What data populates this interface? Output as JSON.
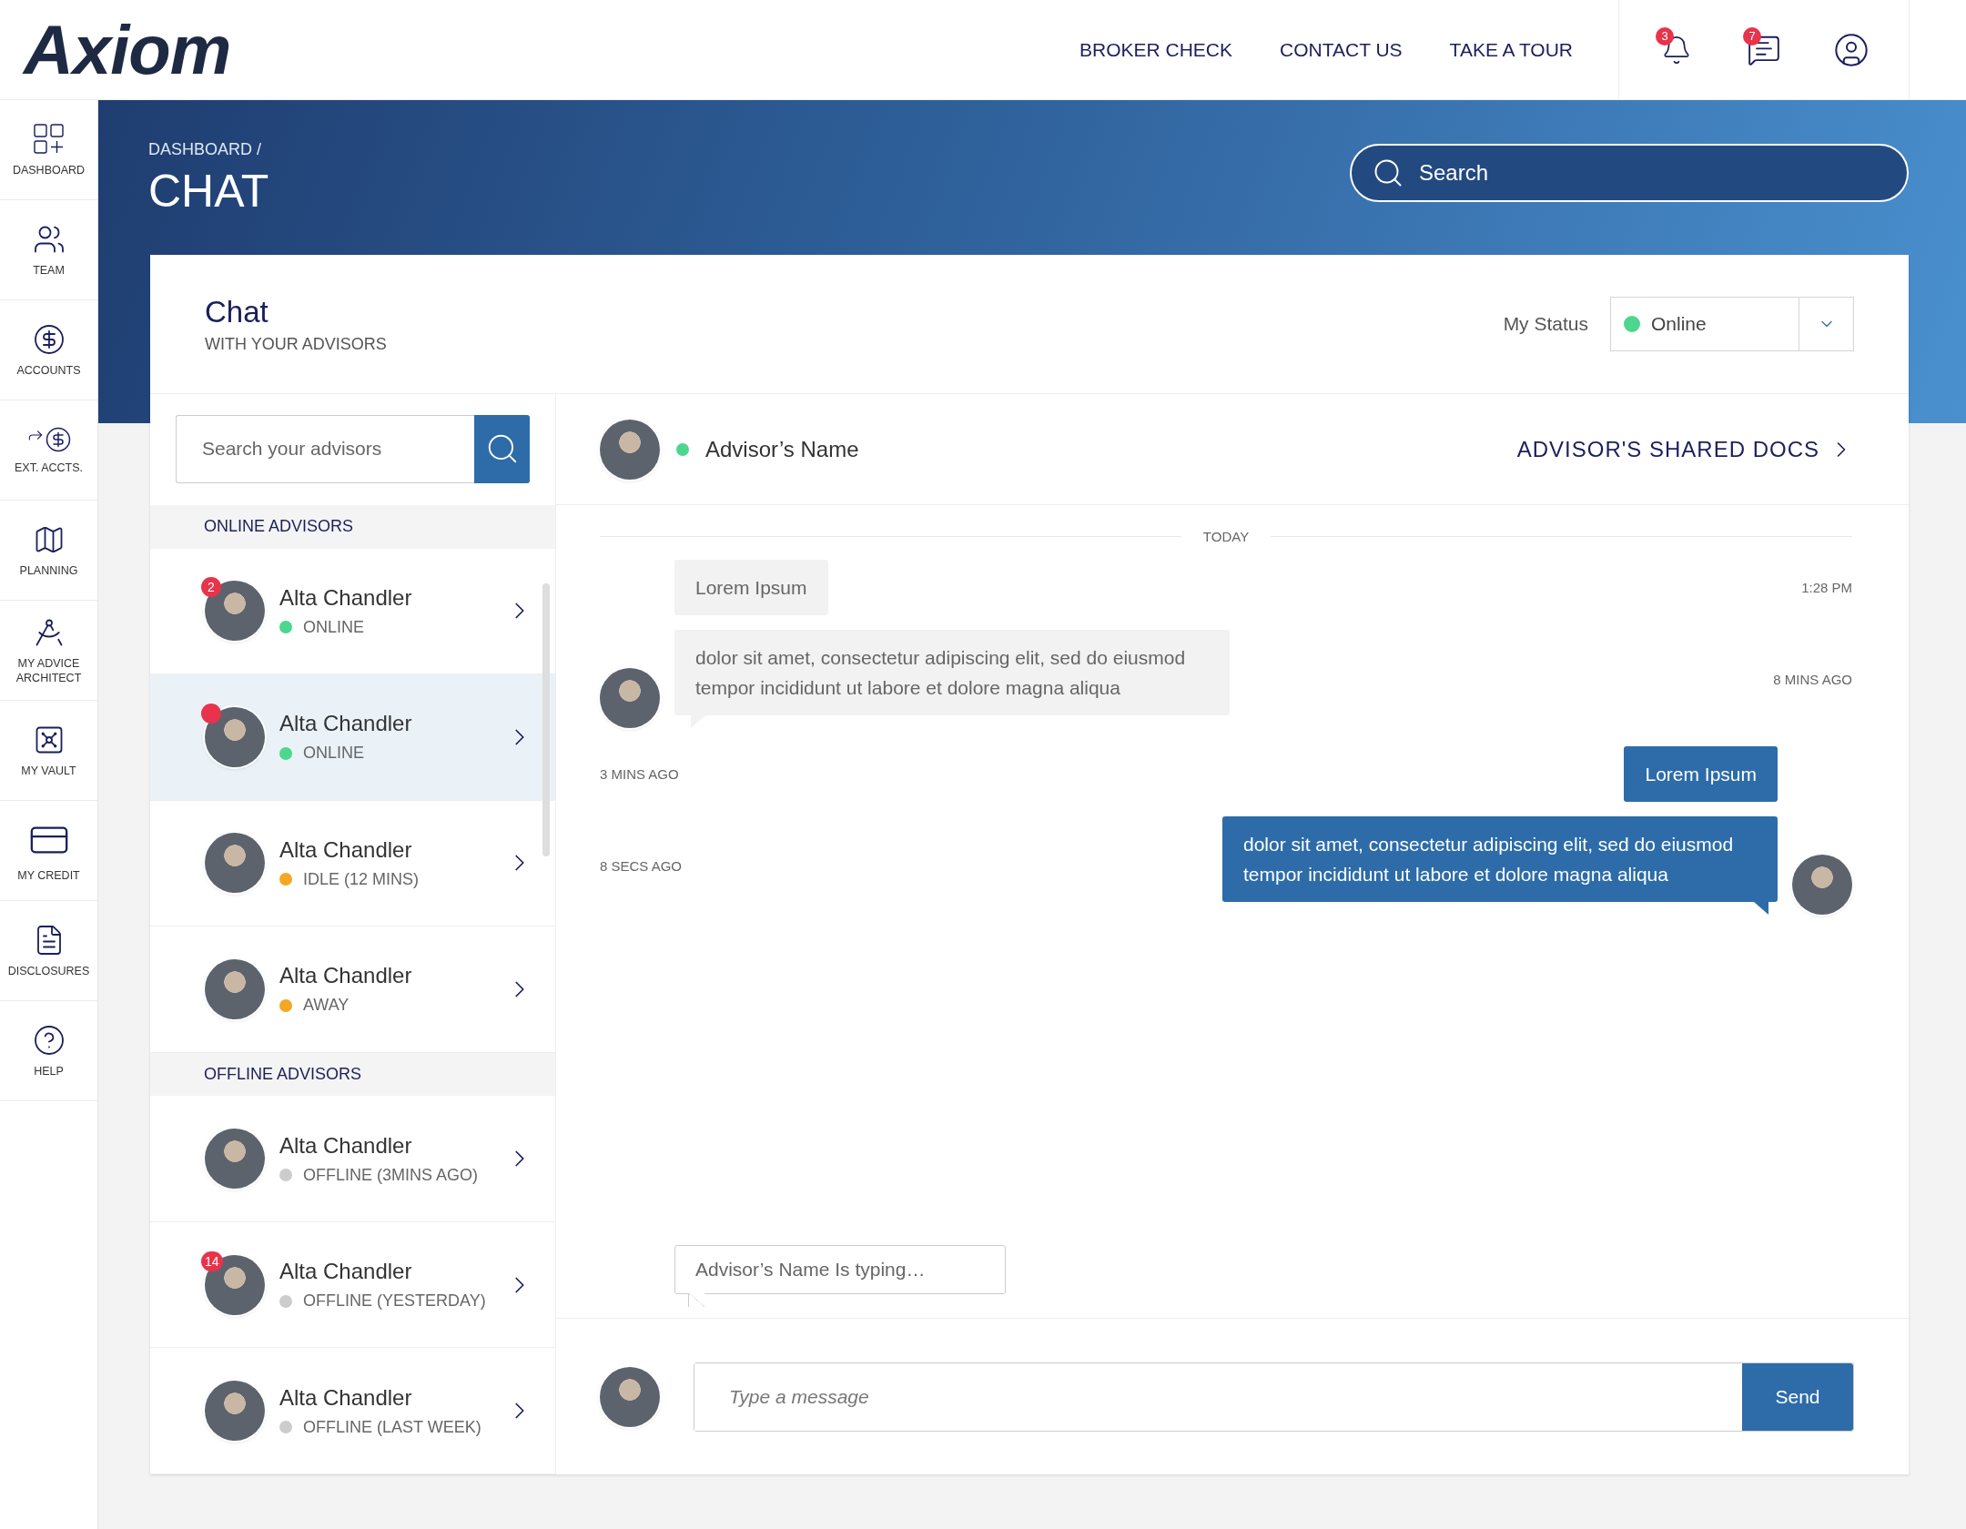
{
  "logo": "Axiom",
  "nav": [
    "BROKER CHECK",
    "CONTACT US",
    "TAKE A TOUR"
  ],
  "header_icons": [
    {
      "kind": "bell",
      "badge": "3"
    },
    {
      "kind": "chat",
      "badge": "7"
    },
    {
      "kind": "profile"
    }
  ],
  "sidebar": [
    {
      "kind": "dashboard",
      "label": "DASHBOARD"
    },
    {
      "kind": "team",
      "label": "TEAM"
    },
    {
      "kind": "accounts",
      "label": "ACCOUNTS"
    },
    {
      "kind": "external",
      "label": "EXT. ACCTS."
    },
    {
      "kind": "planning",
      "label": "PLANNING"
    },
    {
      "kind": "architect",
      "label": "MY ADVICE ARCHITECT"
    },
    {
      "kind": "vault",
      "label": "MY VAULT"
    },
    {
      "kind": "credit",
      "label": "MY CREDIT"
    },
    {
      "kind": "disclosures",
      "label": "DISCLOSURES"
    },
    {
      "kind": "help",
      "label": "HELP"
    }
  ],
  "breadcrumb": "DASHBOARD /",
  "page_title": "CHAT",
  "search": {
    "placeholder": "Search"
  },
  "card": {
    "title": "Chat",
    "subtitle": "WITH YOUR ADVISORS",
    "status_label": "My Status",
    "status": {
      "value": "Online",
      "color": "#4cd68e"
    }
  },
  "advisor_search": {
    "placeholder": "Search your advisors"
  },
  "sections": [
    {
      "title": "ONLINE ADVISORS",
      "advisors": [
        {
          "name": "Alta Chandler",
          "status": "ONLINE",
          "color": "#4cd68e",
          "badge": {
            "kind": "count",
            "text": "2"
          },
          "selected": false
        },
        {
          "name": "Alta Chandler",
          "status": "ONLINE",
          "color": "#4cd68e",
          "badge": {
            "kind": "dot"
          },
          "selected": true
        },
        {
          "name": "Alta Chandler",
          "status": "IDLE (12 MINS)",
          "color": "#f5a623",
          "selected": false
        },
        {
          "name": "Alta Chandler",
          "status": "AWAY",
          "color": "#f5a623",
          "selected": false
        }
      ]
    },
    {
      "title": "OFFLINE ADVISORS",
      "advisors": [
        {
          "name": "Alta Chandler",
          "status": "OFFLINE (3MINS AGO)",
          "color": "#cccccc",
          "selected": false
        },
        {
          "name": "Alta Chandler",
          "status": "OFFLINE (YESTERDAY)",
          "color": "#cccccc",
          "badge": {
            "kind": "count",
            "text": "14"
          },
          "selected": false
        },
        {
          "name": "Alta Chandler",
          "status": "OFFLINE (LAST WEEK)",
          "color": "#cccccc",
          "selected": false
        }
      ]
    }
  ],
  "conversation": {
    "advisor": {
      "name": "Advisor’s Name",
      "color": "#4cd68e"
    },
    "shared_docs": "ADVISOR'S SHARED DOCS",
    "day": "TODAY",
    "messages": [
      {
        "kind": "incoming",
        "text": "Lorem Ipsum",
        "time": "1:28 PM",
        "avatar": false
      },
      {
        "kind": "incoming",
        "text": "dolor sit amet, consectetur adipiscing elit, sed do eiusmod tempor incididunt ut labore et dolore magna aliqua",
        "time": "8 MINS AGO",
        "avatar": true
      },
      {
        "kind": "outgoing",
        "text": "Lorem Ipsum",
        "time": "3 MINS AGO",
        "avatar": false
      },
      {
        "kind": "outgoing",
        "text": "dolor sit amet, consectetur adipiscing elit, sed do eiusmod tempor incididunt ut labore et dolore magna aliqua",
        "time": "8 SECS AGO",
        "avatar": true
      }
    ],
    "typing": "Advisor’s Name Is typing…",
    "composer": {
      "placeholder": "Type a message",
      "send": "Send"
    }
  }
}
